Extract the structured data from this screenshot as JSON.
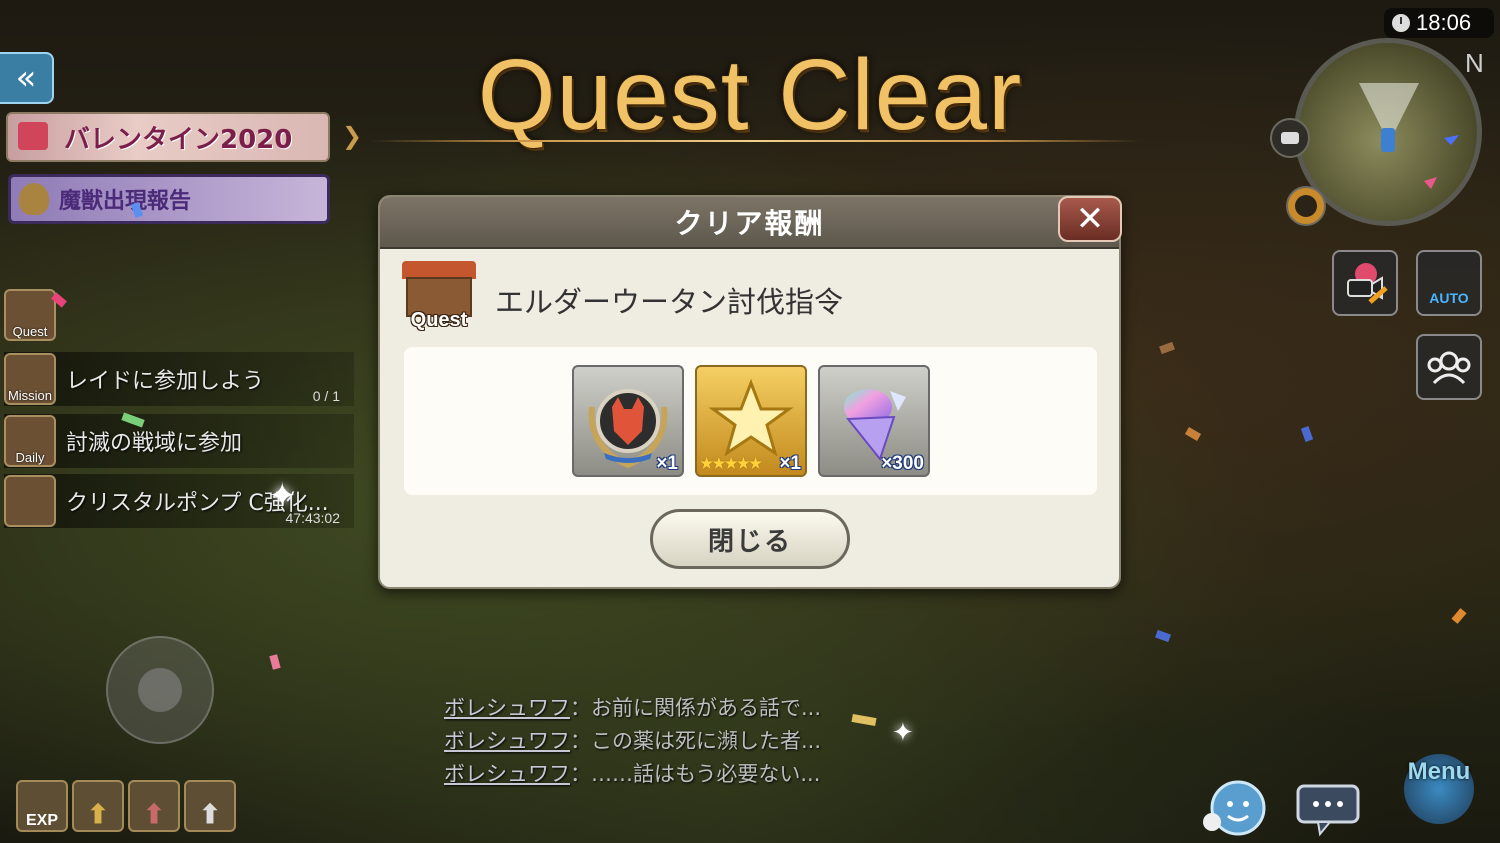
{
  "title": "Quest Clear",
  "clock": "18:06",
  "minimap": {
    "north_label": "N"
  },
  "left_hud": {
    "event_banner": "バレンタイン2020",
    "monster_report": "魔獣出現報告",
    "rows": [
      {
        "icon_label": "Quest",
        "text": ""
      },
      {
        "icon_label": "Mission",
        "text": "レイドに参加しよう",
        "sub": "0 / 1"
      },
      {
        "icon_label": "Daily",
        "text": "討滅の戦域に参加"
      },
      {
        "icon_label": "",
        "text": "クリスタルポンプ C強化...",
        "sub": "47:43:02"
      }
    ],
    "bottom_buttons": [
      "EXP",
      "",
      "",
      ""
    ]
  },
  "right_hud": {
    "auto_label": "AUTO",
    "menu_label": "Menu"
  },
  "dialog": {
    "header": "クリア報酬",
    "quest_badge_label": "Quest",
    "quest_name": "エルダーウータン討伐指令",
    "rewards": [
      {
        "icon": "demon-emblem-icon",
        "quantity": "×1"
      },
      {
        "icon": "gold-star-icon",
        "stars": "★★★★★",
        "quantity": "×1"
      },
      {
        "icon": "rainbow-crystal-icon",
        "quantity": "×300"
      }
    ],
    "close_button": "閉じる"
  },
  "chat": [
    {
      "name": "ボレシュワフ",
      "message": "：お前に関係がある話で..."
    },
    {
      "name": "ボレシュワフ",
      "message": "：この薬は死に瀕した者..."
    },
    {
      "name": "ボレシュワフ",
      "message": "：……話はもう必要ない..."
    }
  ],
  "colors": {
    "title_gold": "#f0c265",
    "dialog_bg": "#efece1",
    "dialog_header": "#6b6458",
    "close_red": "#8a3b30"
  }
}
